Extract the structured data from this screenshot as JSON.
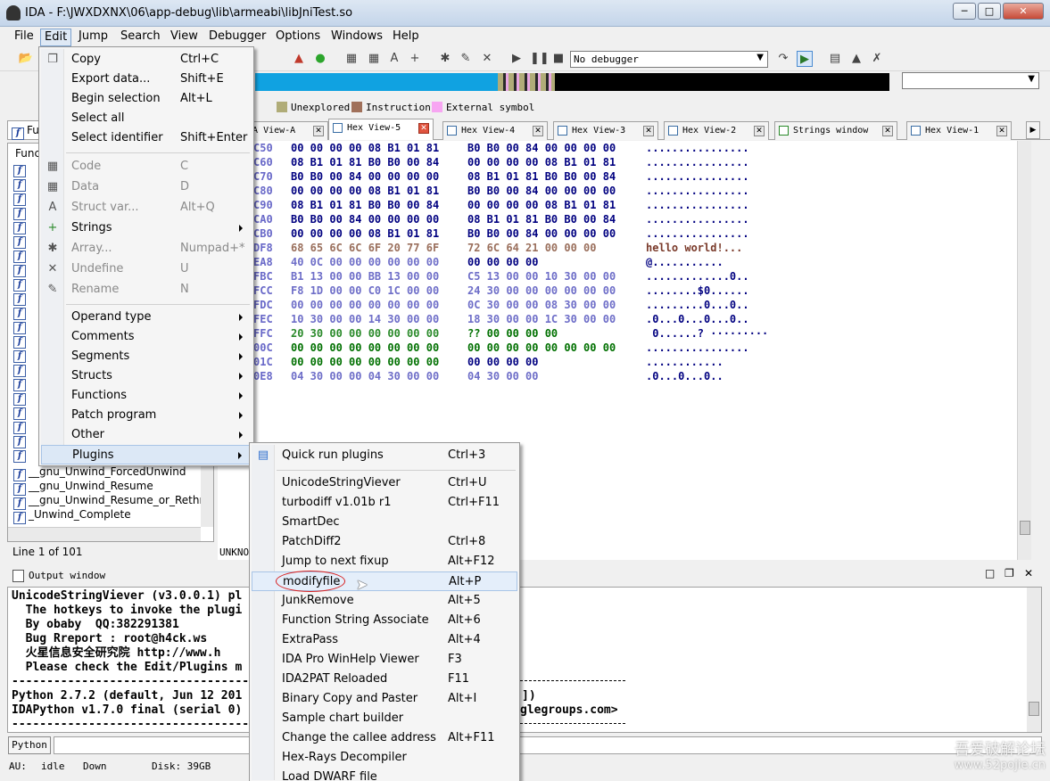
{
  "window": {
    "title": "IDA - F:\\JWXDXNX\\06\\app-debug\\lib\\armeabi\\libJniTest.so"
  },
  "menubar": [
    "File",
    "Edit",
    "Jump",
    "Search",
    "View",
    "Debugger",
    "Options",
    "Windows",
    "Help"
  ],
  "toolbar": {
    "debugger_select": "No debugger"
  },
  "legend": [
    "Unexplored",
    "Instruction",
    "External symbol"
  ],
  "tabs": [
    "IDA View-A",
    "Hex View-5",
    "Hex View-4",
    "Hex View-3",
    "Hex View-2",
    "Strings window",
    "Hex View-1"
  ],
  "functions": {
    "header": "Func",
    "visible_names": [
      "__gnu_Unwind_ForcedUnwind",
      "__gnu_Unwind_Resume",
      "__gnu_Unwind_Resume_or_Rethr",
      "_Unwind_Complete"
    ],
    "status": "Line 1 of 101"
  },
  "hex": {
    "lines": [
      {
        "addr": "C50",
        "bytes1": "00 00 00 00 08 B1 01 81",
        "bytes2": "B0 B0 00 84 00 00 00 00",
        "ascii": "................"
      },
      {
        "addr": "C60",
        "bytes1": "08 B1 01 81 B0 B0 00 84",
        "bytes2": "00 00 00 00 08 B1 01 81",
        "ascii": "................"
      },
      {
        "addr": "C70",
        "bytes1": "B0 B0 00 84 00 00 00 00",
        "bytes2": "08 B1 01 81 B0 B0 00 84",
        "ascii": "................"
      },
      {
        "addr": "C80",
        "bytes1": "00 00 00 00 08 B1 01 81",
        "bytes2": "B0 B0 00 84 00 00 00 00",
        "ascii": "................"
      },
      {
        "addr": "C90",
        "bytes1": "08 B1 01 81 B0 B0 00 84",
        "bytes2": "00 00 00 00 08 B1 01 81",
        "ascii": "................"
      },
      {
        "addr": "CA0",
        "bytes1": "B0 B0 00 84 00 00 00 00",
        "bytes2": "08 B1 01 81 B0 B0 00 84",
        "ascii": "................"
      },
      {
        "addr": "CB0",
        "bytes1": "00 00 00 00 08 B1 01 81",
        "bytes2": "B0 B0 00 84 00 00 00 00",
        "ascii": "................"
      },
      {
        "addr": "DF8",
        "bytes1": "68 65 6C 6C 6F 20 77 6F",
        "bytes2": "72 6C 64 21 00 00 00",
        "ascii": "hello world!..."
      },
      {
        "addr": "EA8",
        "bytes1": "40 0C 00 00 00 00 00 00",
        "bytes2": "00 00 00 00",
        "ascii": "@..........."
      },
      {
        "addr": "FBC",
        "bytes1": "B1 13 00 00 BB 13 00 00",
        "bytes2": "C5 13 00 00 10 30 00 00",
        "ascii": ".............0.."
      },
      {
        "addr": "FCC",
        "bytes1": "F8 1D 00 00 C0 1C 00 00",
        "bytes2": "24 30 00 00 00 00 00 00",
        "ascii": "........$0......"
      },
      {
        "addr": "FDC",
        "bytes1": "00 00 00 00 00 00 00 00",
        "bytes2": "0C 30 00 00 08 30 00 00",
        "ascii": ".........0...0.."
      },
      {
        "addr": "FEC",
        "bytes1": "10 30 00 00 14 30 00 00",
        "bytes2": "18 30 00 00 1C 30 00 00",
        "ascii": ".0...0...0...0.."
      },
      {
        "addr": "FFC",
        "bytes1": "20 30 00 00 00 00 00 00",
        "bytes2": "?? 00 00 00 00",
        "ascii": " 0......? ·········"
      },
      {
        "addr": "00C",
        "bytes1": "00 00 00 00 00 00 00 00",
        "bytes2": "00 00 00 00 00 00 00 00",
        "ascii": "................"
      },
      {
        "addr": "01C",
        "bytes1": "00 00 00 00 00 00 00 00",
        "bytes2": "00 00 00 00",
        "ascii": "............"
      },
      {
        "addr": "0E8",
        "bytes1": "04 30 00 00 04 30 00 00",
        "bytes2": "04 30 00 00",
        "ascii": ".0...0...0.."
      }
    ],
    "status": "UNKNO"
  },
  "edit_menu": {
    "items": [
      {
        "label": "Copy",
        "shortcut": "Ctrl+C",
        "icon": "copy-icon",
        "enabled": true
      },
      {
        "label": "Export data...",
        "shortcut": "Shift+E",
        "enabled": true
      },
      {
        "label": "Begin selection",
        "shortcut": "Alt+L",
        "enabled": true
      },
      {
        "label": "Select all",
        "shortcut": "",
        "enabled": true
      },
      {
        "label": "Select identifier",
        "shortcut": "Shift+Enter",
        "enabled": true
      },
      {
        "label": "Code",
        "shortcut": "C",
        "icon": "code-icon",
        "enabled": false
      },
      {
        "label": "Data",
        "shortcut": "D",
        "icon": "data-icon",
        "enabled": false
      },
      {
        "label": "Struct var...",
        "shortcut": "Alt+Q",
        "icon": "struct-icon",
        "enabled": false
      },
      {
        "label": "Strings",
        "shortcut": "",
        "icon": "strings-icon",
        "enabled": true,
        "submenu": true
      },
      {
        "label": "Array...",
        "shortcut": "Numpad+*",
        "icon": "array-icon",
        "enabled": false
      },
      {
        "label": "Undefine",
        "shortcut": "U",
        "icon": "undefine-icon",
        "enabled": false
      },
      {
        "label": "Rename",
        "shortcut": "N",
        "icon": "rename-icon",
        "enabled": false
      },
      {
        "label": "Operand type",
        "submenu": true,
        "enabled": true
      },
      {
        "label": "Comments",
        "submenu": true,
        "enabled": true
      },
      {
        "label": "Segments",
        "submenu": true,
        "enabled": true
      },
      {
        "label": "Structs",
        "submenu": true,
        "enabled": true
      },
      {
        "label": "Functions",
        "submenu": true,
        "enabled": true
      },
      {
        "label": "Patch program",
        "submenu": true,
        "enabled": true
      },
      {
        "label": "Other",
        "submenu": true,
        "enabled": true
      },
      {
        "label": "Plugins",
        "submenu": true,
        "enabled": true,
        "highlighted": true
      }
    ]
  },
  "plugins_menu": {
    "items": [
      {
        "label": "Quick run plugins",
        "shortcut": "Ctrl+3"
      },
      {
        "label": "UnicodeStringViever",
        "shortcut": "Ctrl+U"
      },
      {
        "label": "turbodiff v1.01b r1",
        "shortcut": "Ctrl+F11"
      },
      {
        "label": "SmartDec",
        "shortcut": ""
      },
      {
        "label": "PatchDiff2",
        "shortcut": "Ctrl+8"
      },
      {
        "label": "Jump to next fixup",
        "shortcut": "Alt+F12"
      },
      {
        "label": "modifyfile",
        "shortcut": "Alt+P",
        "highlighted": true
      },
      {
        "label": "JunkRemove",
        "shortcut": "Alt+5"
      },
      {
        "label": "Function String Associate",
        "shortcut": "Alt+6"
      },
      {
        "label": "ExtraPass",
        "shortcut": "Alt+4"
      },
      {
        "label": "IDA Pro WinHelp Viewer",
        "shortcut": "F3"
      },
      {
        "label": "IDA2PAT Reloaded",
        "shortcut": "F11"
      },
      {
        "label": "Binary Copy and Paster",
        "shortcut": "Alt+I"
      },
      {
        "label": "Sample chart builder",
        "shortcut": ""
      },
      {
        "label": "Change the callee address",
        "shortcut": "Alt+F11"
      },
      {
        "label": "Hex-Rays Decompiler",
        "shortcut": ""
      },
      {
        "label": "Load DWARF file",
        "shortcut": ""
      }
    ]
  },
  "output": {
    "title": "Output window",
    "lines": [
      "UnicodeStringViever (v3.0.0.1) pl",
      "  The hotkeys to invoke the plugi",
      "  By obaby  QQ:382291381",
      "  Bug Rreport : root@h4ck.ws",
      "  火星信息安全研究院 http://www.h",
      "  Please check the Edit/Plugins m",
      "----------------------------------",
      "Python 2.7.2 (default, Jun 12 201",
      "IDAPython v1.7.0 final (serial 0)",
      "----------------------------------"
    ],
    "right_fragments": [
      "])",
      "glegroups.com>"
    ],
    "python_button": "Python"
  },
  "status": {
    "au": "AU:",
    "state": "idle",
    "direction": "Down",
    "disk": "Disk: 39GB"
  },
  "watermark": {
    "line1": "吾爱破解论坛",
    "line2": "www.52pojie.cn"
  }
}
